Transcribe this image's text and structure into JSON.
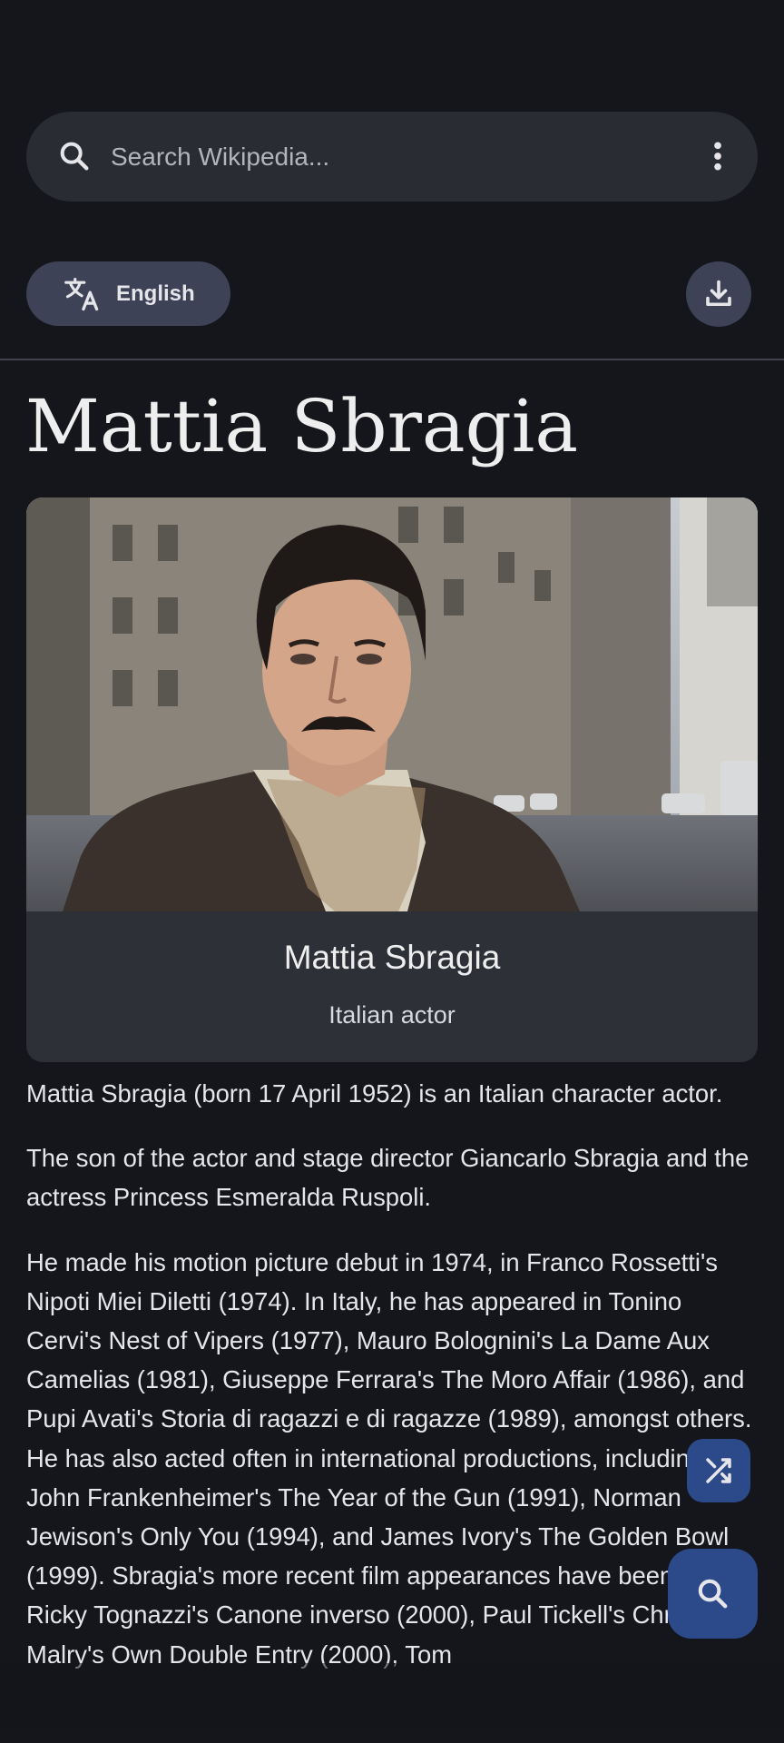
{
  "search": {
    "placeholder": "Search Wikipedia..."
  },
  "language": {
    "label": "English"
  },
  "article": {
    "title": "Mattia Sbragia",
    "lead_card": {
      "title": "Mattia Sbragia",
      "subtitle": "Italian actor"
    },
    "paragraphs": [
      "Mattia Sbragia (born 17 April 1952) is an Italian character actor.",
      "The son of the actor and stage director Giancarlo Sbragia and the actress Princess Esmeralda Ruspoli.",
      "He made his motion picture debut in 1974, in Franco Rossetti's Nipoti Miei Diletti (1974). In Italy, he has appeared in Tonino Cervi's Nest of Vipers (1977), Mauro Bolognini's La Dame Aux Camelias (1981), Giuseppe Ferrara's The Moro Affair (1986), and Pupi Avati's Storia di ragazzi e di ragazze (1989), amongst others. He has also acted often in international productions, including John Frankenheimer's The Year of the Gun (1991), Norman Jewison's Only You (1994), and James Ivory's The Golden Bowl (1999). Sbragia's more recent film appearances have been in Ricky Tognazzi's Canone inverso (2000), Paul Tickell's Christie Malry's Own Double Entry (2000), Tom"
    ]
  },
  "icons": {
    "search": "search-icon",
    "overflow": "more-vert-icon",
    "translate": "translate-icon",
    "download": "download-icon",
    "random": "shuffle-icon",
    "search_fab": "search-icon"
  },
  "colors": {
    "background": "#14161c",
    "surface": "#2a2c33",
    "chip": "#3d4256",
    "accent": "#2c4a8a",
    "text": "#e6e6ea"
  }
}
